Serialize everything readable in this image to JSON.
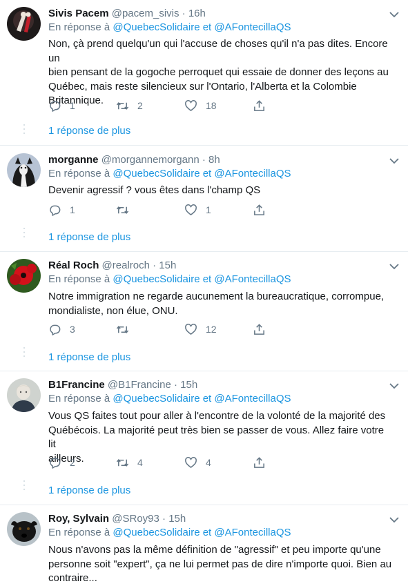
{
  "reply_label": "En réponse à",
  "mention_1": "@QuebecSolidaire",
  "mention_join": "et",
  "mention_2": "@AFontecillaQS",
  "more_label": "1 réponse de plus",
  "colors": {
    "link": "#1b95e0",
    "muted": "#657786",
    "text": "#14171a",
    "separator": "#e6ecf0"
  },
  "tweets": [
    {
      "name": "Sivis Pacem",
      "handle": "@pacem_sivis",
      "dot": "·",
      "time": "16h",
      "lines": [
        "Non, çà prend quelqu'un qui l'accuse de choses qu'il n'a pas dites. Encore un",
        "bien pensant de la gogoche perroquet qui essaie de donner des leçons au",
        "Québec, mais reste silencieux sur l'Ontario, l'Alberta et la Colombie",
        "Britannique."
      ],
      "replies": "1",
      "retweets": "2",
      "likes": "18",
      "avatar_icon": "avatar-dancers-icon"
    },
    {
      "name": "morganne",
      "handle": "@morgannemorgann",
      "dot": "·",
      "time": "8h",
      "lines": [
        "Devenir agressif ? vous êtes dans l'champ QS"
      ],
      "replies": "1",
      "retweets": "",
      "likes": "1",
      "avatar_icon": "avatar-dog-icon"
    },
    {
      "name": "Réal Roch",
      "handle": "@realroch",
      "dot": "·",
      "time": "15h",
      "lines": [
        "Notre immigration ne regarde aucunement la bureaucratique, corrompue,",
        "mondialiste, non élue, ONU."
      ],
      "replies": "3",
      "retweets": "",
      "likes": "12",
      "avatar_icon": "avatar-poppy-icon"
    },
    {
      "name": "B1Francine",
      "handle": "@B1Francine",
      "dot": "·",
      "time": "15h",
      "lines": [
        "Vous QS faites tout pour aller à l'encontre de la volonté de la majorité des",
        "Québécois. La majorité peut très bien se passer de vous. Allez faire votre lit",
        "ailleurs."
      ],
      "replies": "2",
      "retweets": "4",
      "likes": "4",
      "avatar_icon": "avatar-woman-icon"
    },
    {
      "name": "Roy, Sylvain",
      "handle": "@SRoy93",
      "dot": "·",
      "time": "15h",
      "lines": [
        "Nous n'avons pas la même définition de \"agressif\" et peu importe qu'une",
        "personne soit \"expert\", ça ne lui permet pas de dire n'importe quoi.  Bien au",
        "contraire..."
      ],
      "replies": "",
      "retweets": "",
      "likes": "",
      "avatar_icon": "avatar-black-dog-icon"
    }
  ]
}
